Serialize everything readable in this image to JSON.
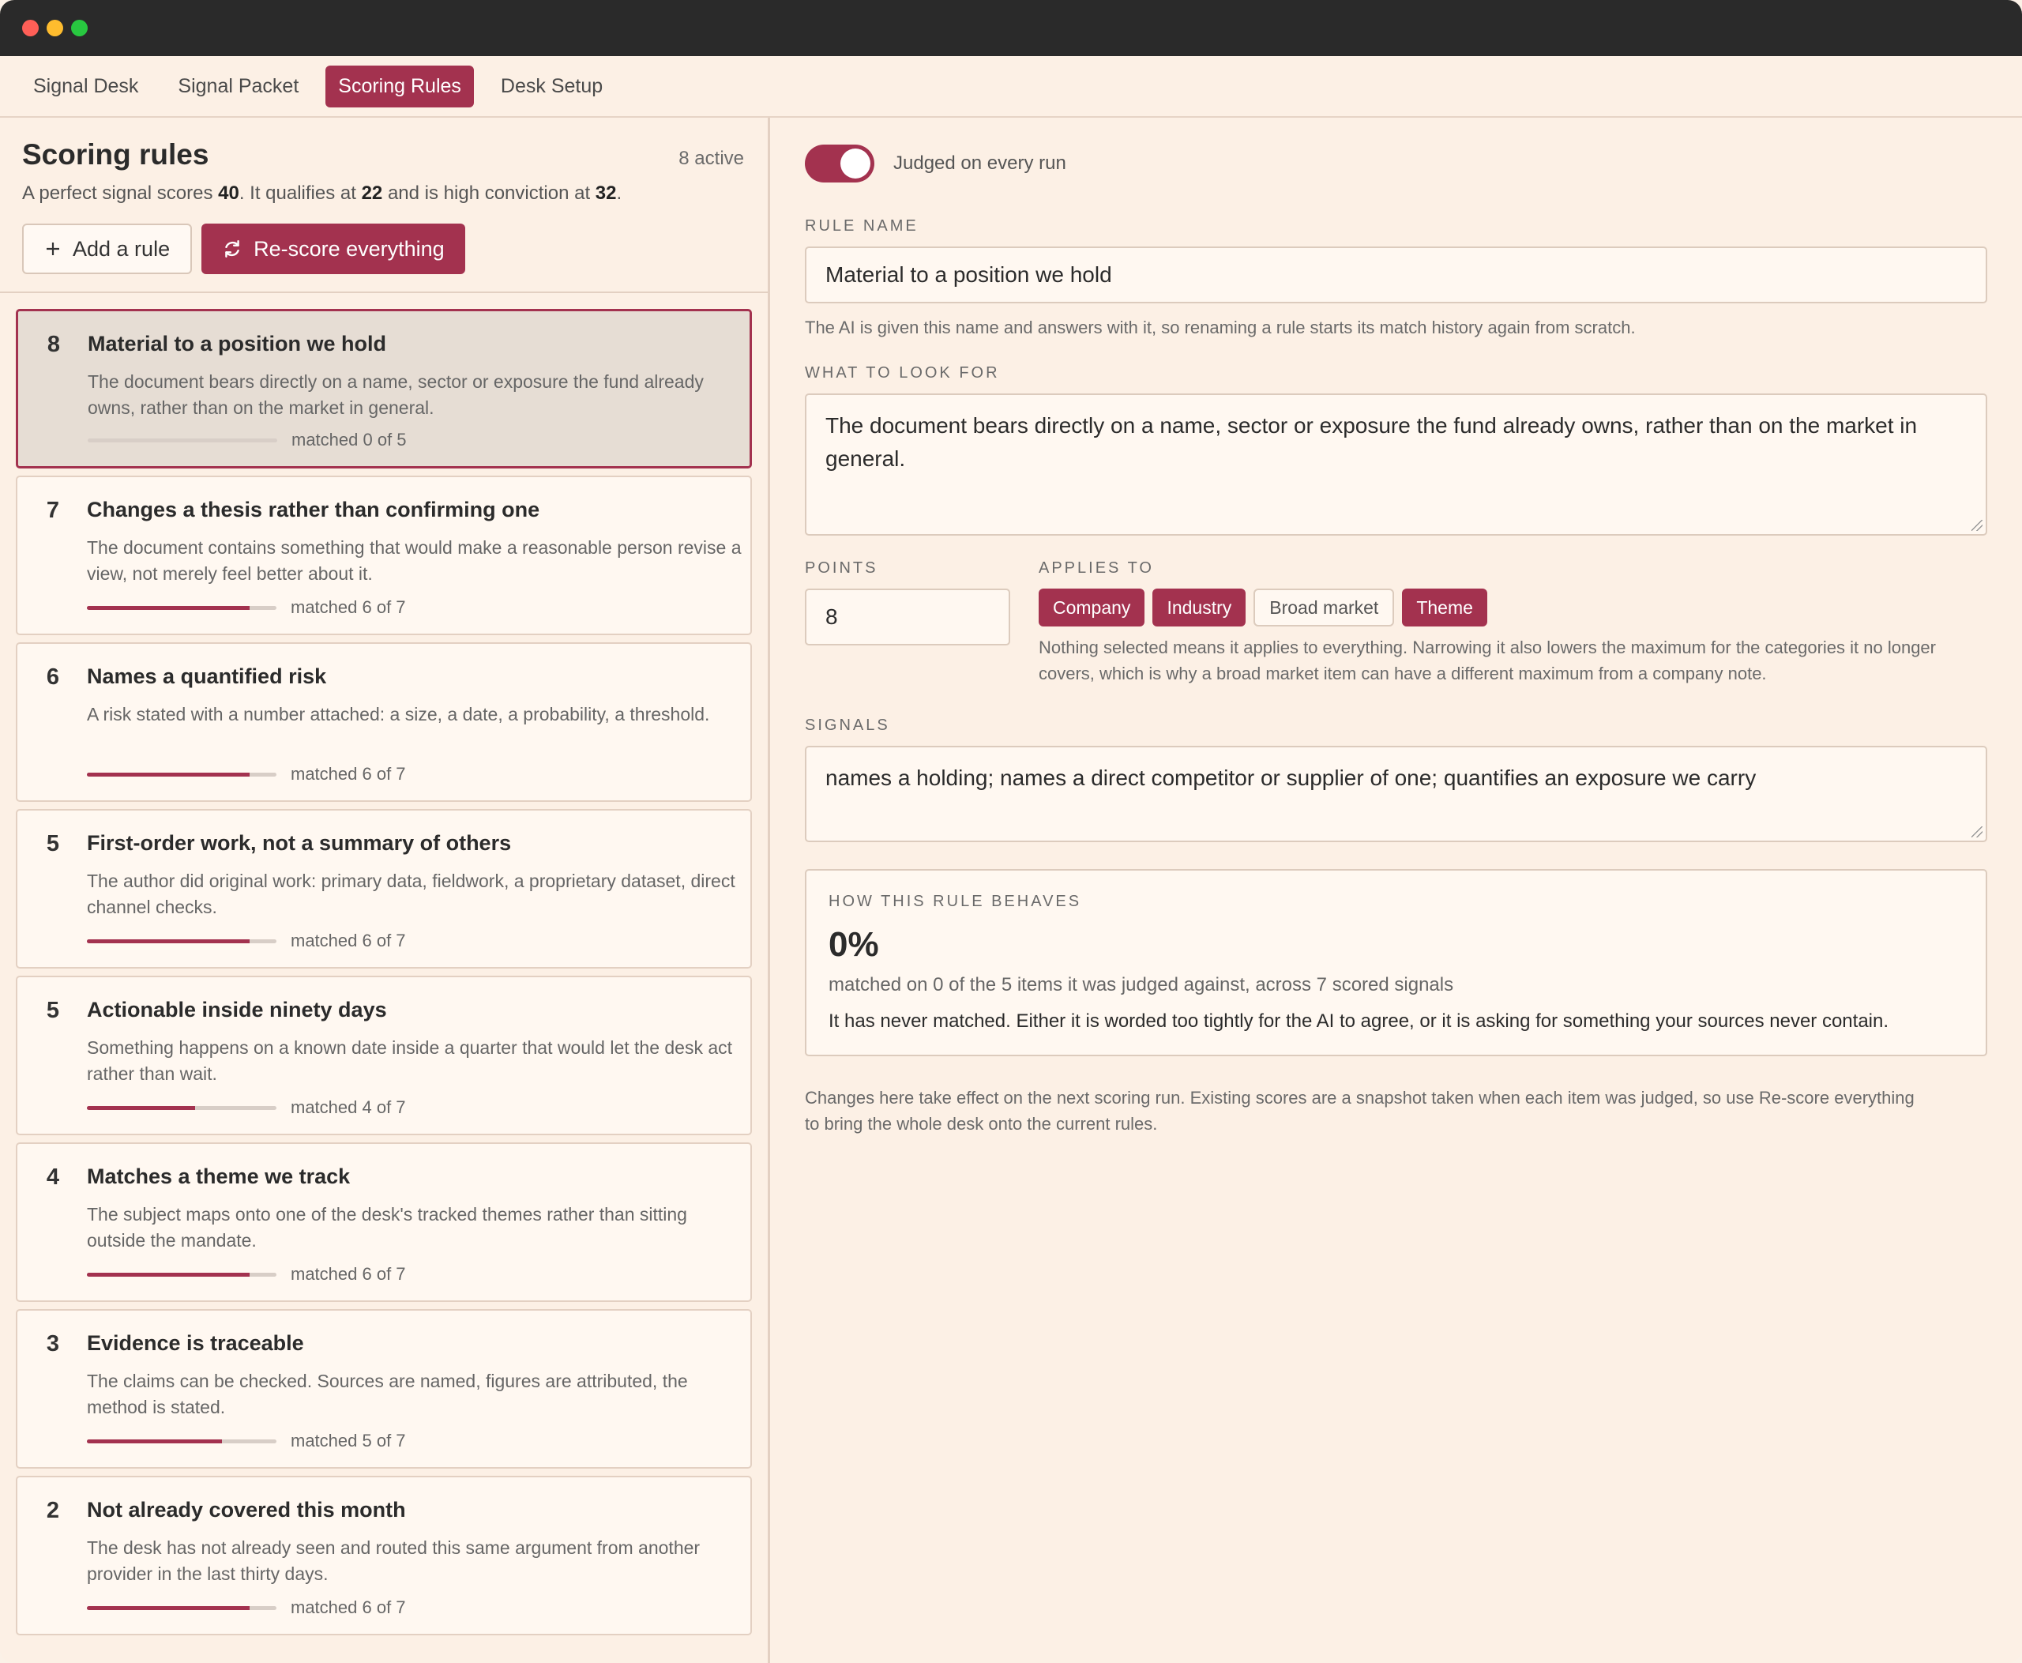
{
  "nav": {
    "tabs": [
      {
        "label": "Signal Desk"
      },
      {
        "label": "Signal Packet"
      },
      {
        "label": "Scoring Rules"
      },
      {
        "label": "Desk Setup"
      }
    ]
  },
  "left": {
    "title": "Scoring rules",
    "active_count": "8 active",
    "summary": {
      "prefix": "A perfect signal scores ",
      "perfect": "40",
      "mid1": ". It qualifies at ",
      "qualifies": "22",
      "mid2": " and is high conviction at ",
      "high": "32",
      "suffix": "."
    },
    "add_label": "Add a rule",
    "rescore_label": "Re-score everything"
  },
  "rules": [
    {
      "points": "8",
      "title": "Material to a position we hold",
      "desc": "The document bears directly on a name, sector or exposure the fund already owns, rather than on the market in general.",
      "matched": "matched 0 of 5",
      "fraction": 0
    },
    {
      "points": "7",
      "title": "Changes a thesis rather than confirming one",
      "desc": "The document contains something that would make a reasonable person revise a view, not merely feel better about it.",
      "matched": "matched 6 of 7",
      "fraction": 0.857
    },
    {
      "points": "6",
      "title": "Names a quantified risk",
      "desc": "A risk stated with a number attached: a size, a date, a probability, a threshold.",
      "matched": "matched 6 of 7",
      "fraction": 0.857
    },
    {
      "points": "5",
      "title": "First-order work, not a summary of others",
      "desc": "The author did original work: primary data, fieldwork, a proprietary dataset, direct channel checks.",
      "matched": "matched 6 of 7",
      "fraction": 0.857
    },
    {
      "points": "5",
      "title": "Actionable inside ninety days",
      "desc": "Something happens on a known date inside a quarter that would let the desk act rather than wait.",
      "matched": "matched 4 of 7",
      "fraction": 0.571
    },
    {
      "points": "4",
      "title": "Matches a theme we track",
      "desc": "The subject maps onto one of the desk's tracked themes rather than sitting outside the mandate.",
      "matched": "matched 6 of 7",
      "fraction": 0.857
    },
    {
      "points": "3",
      "title": "Evidence is traceable",
      "desc": "The claims can be checked. Sources are named, figures are attributed, the method is stated.",
      "matched": "matched 5 of 7",
      "fraction": 0.714
    },
    {
      "points": "2",
      "title": "Not already covered this month",
      "desc": "The desk has not already seen and routed this same argument from another provider in the last thirty days.",
      "matched": "matched 6 of 7",
      "fraction": 0.857
    }
  ],
  "editor": {
    "toggle_label": "Judged on every run",
    "rule_name_label": "RULE NAME",
    "rule_name_value": "Material to a position we hold",
    "rule_name_hint": "The AI is given this name and answers with it, so renaming a rule starts its match history again from scratch.",
    "look_for_label": "WHAT TO LOOK FOR",
    "look_for_value": "The document bears directly on a name, sector or exposure the fund already owns, rather than on the market in general.",
    "points_label": "POINTS",
    "points_value": "8",
    "applies_label": "APPLIES TO",
    "chips": [
      {
        "label": "Company",
        "on": true
      },
      {
        "label": "Industry",
        "on": true
      },
      {
        "label": "Broad market",
        "on": false
      },
      {
        "label": "Theme",
        "on": true
      }
    ],
    "applies_hint": "Nothing selected means it applies to everything. Narrowing it also lowers the maximum for the categories it no longer covers, which is why a broad market item can have a different maximum from a company note.",
    "signals_label": "SIGNALS",
    "signals_value": "names a holding; names a direct competitor or supplier of one; quantifies an exposure we carry",
    "behave_label": "HOW THIS RULE BEHAVES",
    "behave_pct": "0%",
    "behave_sub": "matched on 0 of the 5 items it was judged against, across 7 scored signals",
    "behave_note": "It has never matched. Either it is worded too tightly for the AI to agree, or it is asking for something your sources never contain.",
    "footer_note": "Changes here take effect on the next scoring run. Existing scores are a snapshot taken when each item was judged, so use Re-score everything to bring the whole desk onto the current rules."
  },
  "colors": {
    "accent": "#a3324f",
    "background": "#fcf0e5"
  }
}
